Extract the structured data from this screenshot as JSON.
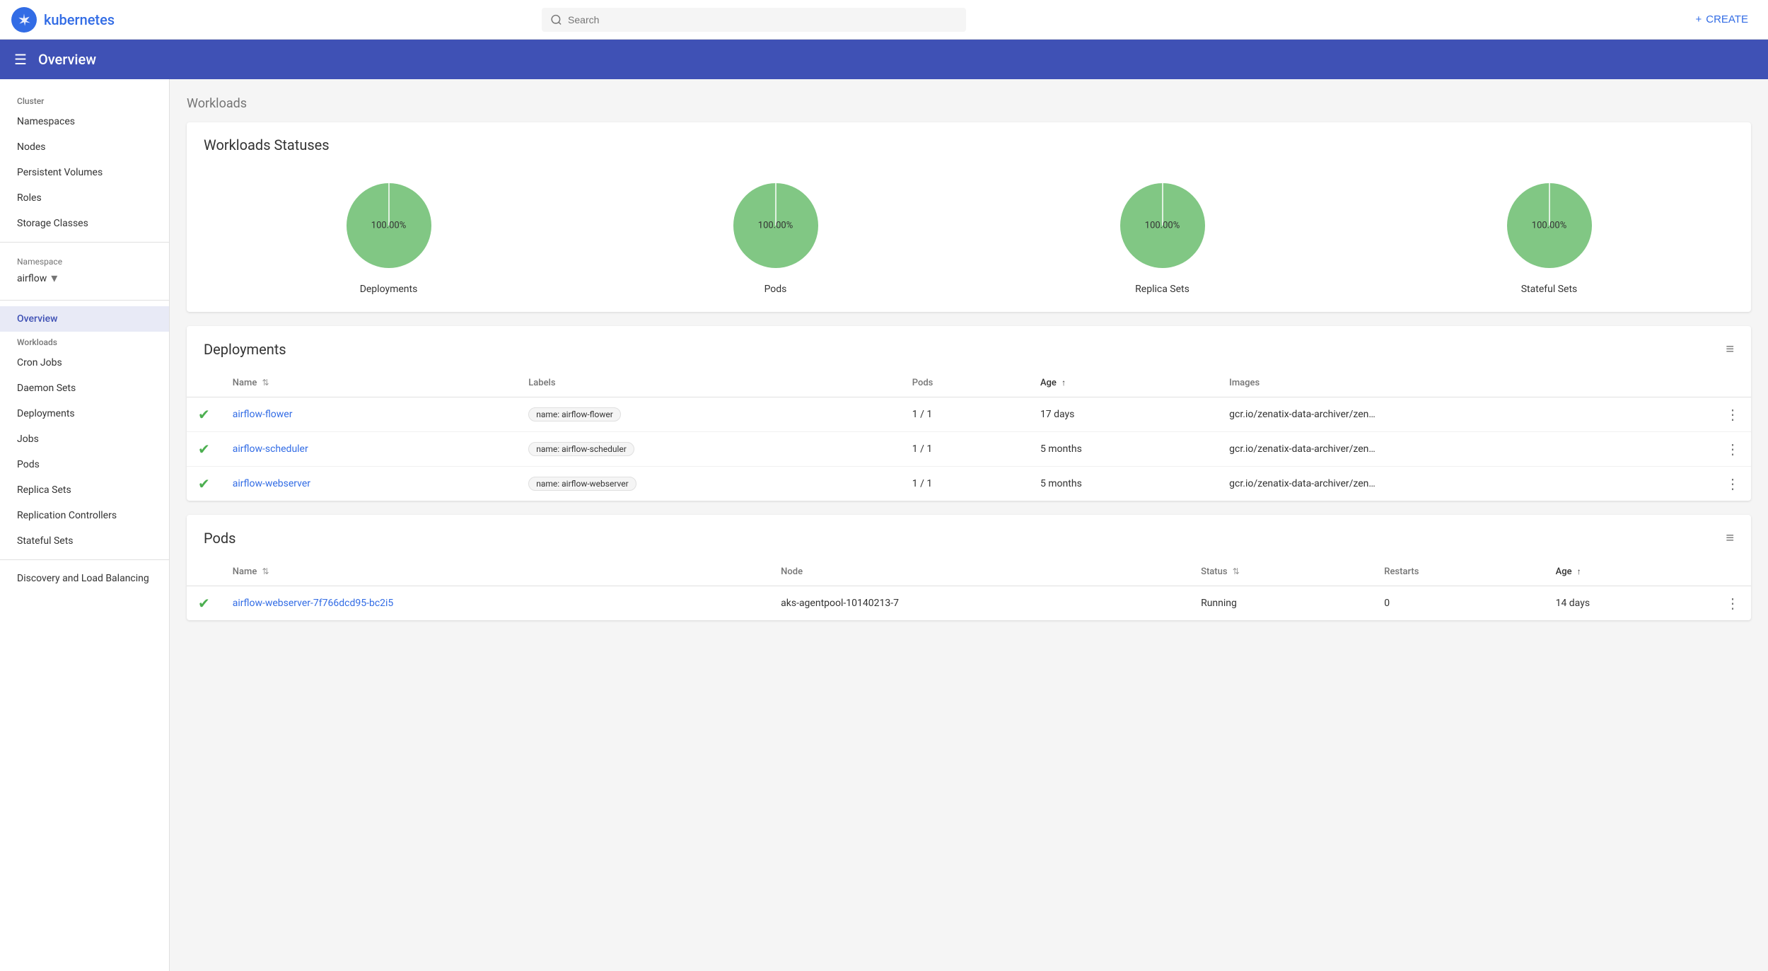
{
  "topnav": {
    "appTitle": "kubernetes",
    "search": {
      "placeholder": "Search"
    },
    "createLabel": "CREATE"
  },
  "header": {
    "title": "Overview",
    "menuIcon": "☰"
  },
  "sidebar": {
    "cluster": {
      "label": "Cluster",
      "items": [
        {
          "id": "namespaces",
          "label": "Namespaces"
        },
        {
          "id": "nodes",
          "label": "Nodes"
        },
        {
          "id": "persistent-volumes",
          "label": "Persistent Volumes"
        },
        {
          "id": "roles",
          "label": "Roles"
        },
        {
          "id": "storage-classes",
          "label": "Storage Classes"
        }
      ]
    },
    "namespace": {
      "label": "Namespace",
      "selected": "airflow"
    },
    "overviewItem": "Overview",
    "workloads": {
      "label": "Workloads",
      "items": [
        {
          "id": "cron-jobs",
          "label": "Cron Jobs"
        },
        {
          "id": "daemon-sets",
          "label": "Daemon Sets"
        },
        {
          "id": "deployments",
          "label": "Deployments"
        },
        {
          "id": "jobs",
          "label": "Jobs"
        },
        {
          "id": "pods",
          "label": "Pods"
        },
        {
          "id": "replica-sets",
          "label": "Replica Sets"
        },
        {
          "id": "replication-controllers",
          "label": "Replication Controllers"
        },
        {
          "id": "stateful-sets",
          "label": "Stateful Sets"
        }
      ]
    },
    "discoveryLabel": "Discovery and Load Balancing"
  },
  "content": {
    "breadcrumb": "Workloads",
    "statusesTitle": "Workloads Statuses",
    "charts": [
      {
        "id": "deployments",
        "label": "Deployments",
        "pct": "100.00%"
      },
      {
        "id": "pods",
        "label": "Pods",
        "pct": "100.00%"
      },
      {
        "id": "replica-sets",
        "label": "Replica Sets",
        "pct": "100.00%"
      },
      {
        "id": "stateful-sets",
        "label": "Stateful Sets",
        "pct": "100.00%"
      }
    ],
    "deployments": {
      "title": "Deployments",
      "columns": [
        {
          "id": "name",
          "label": "Name",
          "sortable": true,
          "bold": false
        },
        {
          "id": "labels",
          "label": "Labels",
          "sortable": false,
          "bold": false
        },
        {
          "id": "pods",
          "label": "Pods",
          "sortable": false,
          "bold": false
        },
        {
          "id": "age",
          "label": "Age",
          "sortable": true,
          "bold": true
        },
        {
          "id": "images",
          "label": "Images",
          "sortable": false,
          "bold": false
        }
      ],
      "rows": [
        {
          "name": "airflow-flower",
          "label": "name: airflow-flower",
          "pods": "1 / 1",
          "age": "17 days",
          "images": "gcr.io/zenatix-data-archiver/zen…"
        },
        {
          "name": "airflow-scheduler",
          "label": "name: airflow-scheduler",
          "pods": "1 / 1",
          "age": "5 months",
          "images": "gcr.io/zenatix-data-archiver/zen…"
        },
        {
          "name": "airflow-webserver",
          "label": "name: airflow-webserver",
          "pods": "1 / 1",
          "age": "5 months",
          "images": "gcr.io/zenatix-data-archiver/zen…"
        }
      ]
    },
    "pods": {
      "title": "Pods",
      "columns": [
        {
          "id": "name",
          "label": "Name",
          "sortable": true,
          "bold": false
        },
        {
          "id": "node",
          "label": "Node",
          "sortable": false,
          "bold": false
        },
        {
          "id": "status",
          "label": "Status",
          "sortable": true,
          "bold": false
        },
        {
          "id": "restarts",
          "label": "Restarts",
          "sortable": false,
          "bold": false
        },
        {
          "id": "age",
          "label": "Age",
          "sortable": true,
          "bold": true
        }
      ],
      "rows": [
        {
          "name": "airflow-webserver-7f766dcd95-bc2i5",
          "node": "aks-agentpool-10140213-7",
          "status": "Running",
          "restarts": "0",
          "age": "14 days"
        }
      ]
    }
  }
}
